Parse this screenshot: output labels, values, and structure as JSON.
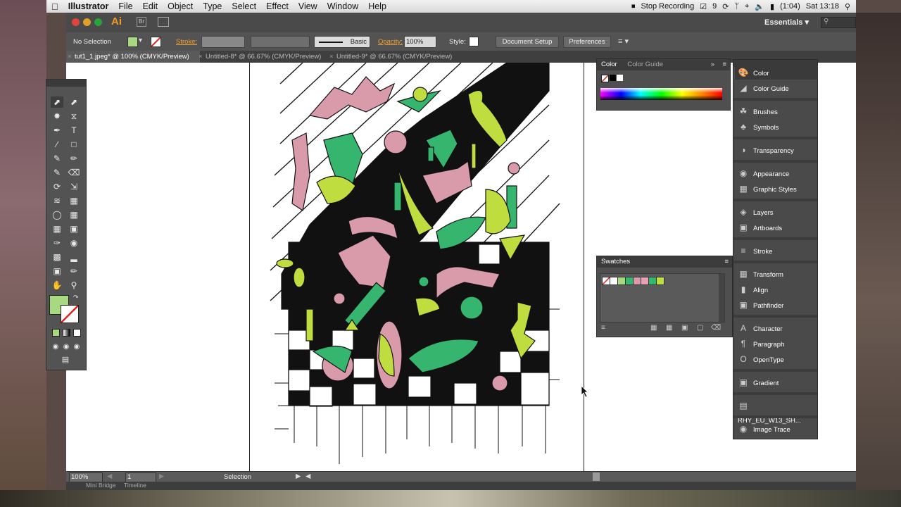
{
  "menubar": {
    "apple_icon": "apple-icon",
    "app_name": "Illustrator",
    "items": [
      "File",
      "Edit",
      "Object",
      "Type",
      "Select",
      "Effect",
      "View",
      "Window",
      "Help"
    ],
    "stop_recording": "Stop Recording",
    "notification_count": "9",
    "battery": "(1:04)",
    "clock": "Sat 13:18"
  },
  "appbar": {
    "logo": "Ai",
    "workspace": "Essentials"
  },
  "controlbar": {
    "selection_label": "No Selection",
    "stroke_label": "Stroke:",
    "stroke_profile": "Basic",
    "opacity_label": "Opacity:",
    "opacity_value": "100%",
    "style_label": "Style:",
    "document_setup": "Document Setup",
    "preferences": "Preferences"
  },
  "tabs": [
    {
      "label": "tut1_1.jpeg* @ 100% (CMYK/Preview)",
      "active": true
    },
    {
      "label": "Untitled-8* @ 66.67% (CMYK/Preview)",
      "active": false
    },
    {
      "label": "Untitled-9* @ 66.67% (CMYK/Preview)",
      "active": false
    }
  ],
  "statusbar": {
    "zoom": "100%",
    "artboard": "1",
    "tool": "Selection"
  },
  "bottombar": {
    "tab1": "Mini Bridge",
    "tab2": "Timeline"
  },
  "color_panel": {
    "tab1": "Color",
    "tab2": "Color Guide"
  },
  "swatches_panel": {
    "title": "Swatches"
  },
  "dock": {
    "items": [
      {
        "label": "Color",
        "icon": "color-icon"
      },
      {
        "label": "Color Guide",
        "icon": "color-guide-icon"
      },
      {
        "label": "Brushes",
        "icon": "brushes-icon"
      },
      {
        "label": "Symbols",
        "icon": "symbols-icon"
      },
      {
        "label": "Transparency",
        "icon": "transparency-icon"
      },
      {
        "label": "Appearance",
        "icon": "appearance-icon"
      },
      {
        "label": "Graphic Styles",
        "icon": "graphic-styles-icon"
      },
      {
        "label": "Layers",
        "icon": "layers-icon"
      },
      {
        "label": "Artboards",
        "icon": "artboards-icon"
      },
      {
        "label": "Stroke",
        "icon": "stroke-icon"
      },
      {
        "label": "Transform",
        "icon": "transform-icon"
      },
      {
        "label": "Align",
        "icon": "align-icon"
      },
      {
        "label": "Pathfinder",
        "icon": "pathfinder-icon"
      },
      {
        "label": "Character",
        "icon": "character-icon"
      },
      {
        "label": "Paragraph",
        "icon": "paragraph-icon"
      },
      {
        "label": "OpenType",
        "icon": "opentype-icon"
      },
      {
        "label": "Gradient",
        "icon": "gradient-icon"
      },
      {
        "label": "RHY_EU_W13_SH...",
        "icon": "library-icon"
      },
      {
        "label": "Image Trace",
        "icon": "image-trace-icon"
      }
    ]
  },
  "colors": {
    "pink": "#d99aaa",
    "green": "#35b56e",
    "lime": "#bfdd3f",
    "fill_swatch": "#a8d880",
    "ui_dark": "#535353"
  }
}
